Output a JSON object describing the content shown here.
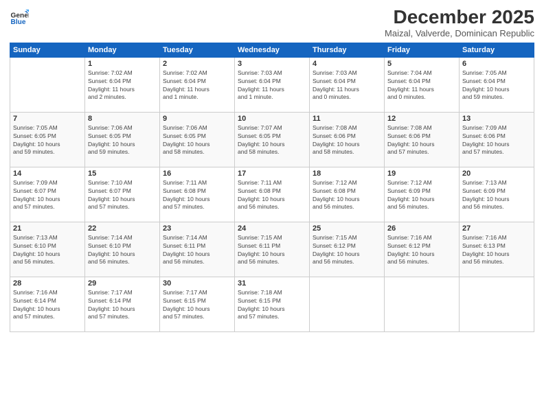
{
  "logo": {
    "general": "General",
    "blue": "Blue"
  },
  "header": {
    "month": "December 2025",
    "location": "Maizal, Valverde, Dominican Republic"
  },
  "weekdays": [
    "Sunday",
    "Monday",
    "Tuesday",
    "Wednesday",
    "Thursday",
    "Friday",
    "Saturday"
  ],
  "weeks": [
    [
      {
        "day": "",
        "info": ""
      },
      {
        "day": "1",
        "info": "Sunrise: 7:02 AM\nSunset: 6:04 PM\nDaylight: 11 hours\nand 2 minutes."
      },
      {
        "day": "2",
        "info": "Sunrise: 7:02 AM\nSunset: 6:04 PM\nDaylight: 11 hours\nand 1 minute."
      },
      {
        "day": "3",
        "info": "Sunrise: 7:03 AM\nSunset: 6:04 PM\nDaylight: 11 hours\nand 1 minute."
      },
      {
        "day": "4",
        "info": "Sunrise: 7:03 AM\nSunset: 6:04 PM\nDaylight: 11 hours\nand 0 minutes."
      },
      {
        "day": "5",
        "info": "Sunrise: 7:04 AM\nSunset: 6:04 PM\nDaylight: 11 hours\nand 0 minutes."
      },
      {
        "day": "6",
        "info": "Sunrise: 7:05 AM\nSunset: 6:04 PM\nDaylight: 10 hours\nand 59 minutes."
      }
    ],
    [
      {
        "day": "7",
        "info": "Sunrise: 7:05 AM\nSunset: 6:05 PM\nDaylight: 10 hours\nand 59 minutes."
      },
      {
        "day": "8",
        "info": "Sunrise: 7:06 AM\nSunset: 6:05 PM\nDaylight: 10 hours\nand 59 minutes."
      },
      {
        "day": "9",
        "info": "Sunrise: 7:06 AM\nSunset: 6:05 PM\nDaylight: 10 hours\nand 58 minutes."
      },
      {
        "day": "10",
        "info": "Sunrise: 7:07 AM\nSunset: 6:05 PM\nDaylight: 10 hours\nand 58 minutes."
      },
      {
        "day": "11",
        "info": "Sunrise: 7:08 AM\nSunset: 6:06 PM\nDaylight: 10 hours\nand 58 minutes."
      },
      {
        "day": "12",
        "info": "Sunrise: 7:08 AM\nSunset: 6:06 PM\nDaylight: 10 hours\nand 57 minutes."
      },
      {
        "day": "13",
        "info": "Sunrise: 7:09 AM\nSunset: 6:06 PM\nDaylight: 10 hours\nand 57 minutes."
      }
    ],
    [
      {
        "day": "14",
        "info": "Sunrise: 7:09 AM\nSunset: 6:07 PM\nDaylight: 10 hours\nand 57 minutes."
      },
      {
        "day": "15",
        "info": "Sunrise: 7:10 AM\nSunset: 6:07 PM\nDaylight: 10 hours\nand 57 minutes."
      },
      {
        "day": "16",
        "info": "Sunrise: 7:11 AM\nSunset: 6:08 PM\nDaylight: 10 hours\nand 57 minutes."
      },
      {
        "day": "17",
        "info": "Sunrise: 7:11 AM\nSunset: 6:08 PM\nDaylight: 10 hours\nand 56 minutes."
      },
      {
        "day": "18",
        "info": "Sunrise: 7:12 AM\nSunset: 6:08 PM\nDaylight: 10 hours\nand 56 minutes."
      },
      {
        "day": "19",
        "info": "Sunrise: 7:12 AM\nSunset: 6:09 PM\nDaylight: 10 hours\nand 56 minutes."
      },
      {
        "day": "20",
        "info": "Sunrise: 7:13 AM\nSunset: 6:09 PM\nDaylight: 10 hours\nand 56 minutes."
      }
    ],
    [
      {
        "day": "21",
        "info": "Sunrise: 7:13 AM\nSunset: 6:10 PM\nDaylight: 10 hours\nand 56 minutes."
      },
      {
        "day": "22",
        "info": "Sunrise: 7:14 AM\nSunset: 6:10 PM\nDaylight: 10 hours\nand 56 minutes."
      },
      {
        "day": "23",
        "info": "Sunrise: 7:14 AM\nSunset: 6:11 PM\nDaylight: 10 hours\nand 56 minutes."
      },
      {
        "day": "24",
        "info": "Sunrise: 7:15 AM\nSunset: 6:11 PM\nDaylight: 10 hours\nand 56 minutes."
      },
      {
        "day": "25",
        "info": "Sunrise: 7:15 AM\nSunset: 6:12 PM\nDaylight: 10 hours\nand 56 minutes."
      },
      {
        "day": "26",
        "info": "Sunrise: 7:16 AM\nSunset: 6:12 PM\nDaylight: 10 hours\nand 56 minutes."
      },
      {
        "day": "27",
        "info": "Sunrise: 7:16 AM\nSunset: 6:13 PM\nDaylight: 10 hours\nand 56 minutes."
      }
    ],
    [
      {
        "day": "28",
        "info": "Sunrise: 7:16 AM\nSunset: 6:14 PM\nDaylight: 10 hours\nand 57 minutes."
      },
      {
        "day": "29",
        "info": "Sunrise: 7:17 AM\nSunset: 6:14 PM\nDaylight: 10 hours\nand 57 minutes."
      },
      {
        "day": "30",
        "info": "Sunrise: 7:17 AM\nSunset: 6:15 PM\nDaylight: 10 hours\nand 57 minutes."
      },
      {
        "day": "31",
        "info": "Sunrise: 7:18 AM\nSunset: 6:15 PM\nDaylight: 10 hours\nand 57 minutes."
      },
      {
        "day": "",
        "info": ""
      },
      {
        "day": "",
        "info": ""
      },
      {
        "day": "",
        "info": ""
      }
    ]
  ]
}
